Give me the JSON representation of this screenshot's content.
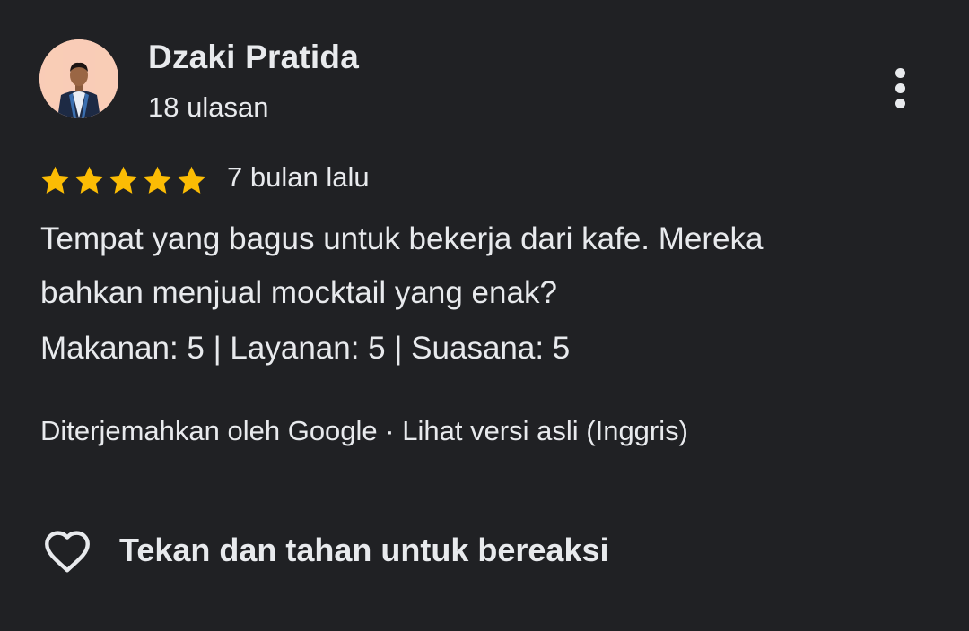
{
  "review": {
    "author": {
      "name": "Dzaki Pratida",
      "review_count": "18 ulasan",
      "avatar": "profile-photo"
    },
    "rating": {
      "stars": 5,
      "max": 5,
      "star_color": "#fbbc04"
    },
    "time_ago": "7 bulan lalu",
    "text_line_1": "Tempat yang bagus untuk bekerja dari kafe. Mereka",
    "text_line_2": "bahkan menjual mocktail yang enak?",
    "ratings_line": "Makanan: 5 | Layanan: 5 | Suasana: 5",
    "translation": {
      "translated_by": "Diterjemahkan oleh Google",
      "separator": " · ",
      "original_link": "Lihat versi asli (Inggris)"
    },
    "reaction": {
      "icon": "heart-outline-icon",
      "label": "Tekan dan tahan untuk bereaksi"
    },
    "menu_icon": "more-vert-icon"
  },
  "colors": {
    "background": "#202124",
    "text": "#e8eaed",
    "star": "#fbbc04",
    "top_rule": "#5f6164"
  }
}
